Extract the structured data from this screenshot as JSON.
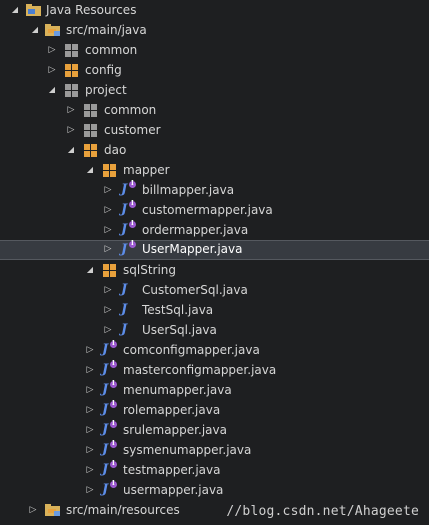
{
  "tree": {
    "root": {
      "label": "Java Resources",
      "icon": "java-resources-icon"
    },
    "src_main_java": {
      "label": "src/main/java",
      "icon": "source-folder-icon"
    },
    "common": {
      "label": "common",
      "icon": "package-icon"
    },
    "config": {
      "label": "config",
      "icon": "package-icon"
    },
    "project": {
      "label": "project",
      "icon": "package-icon"
    },
    "project_common": {
      "label": "common",
      "icon": "package-icon"
    },
    "customer": {
      "label": "customer",
      "icon": "package-icon"
    },
    "dao": {
      "label": "dao",
      "icon": "package-icon"
    },
    "mapper": {
      "label": "mapper",
      "icon": "package-icon"
    },
    "mapper_files": [
      {
        "label": "billmapper.java",
        "icon": "java-interface-icon"
      },
      {
        "label": "customermapper.java",
        "icon": "java-interface-icon"
      },
      {
        "label": "ordermapper.java",
        "icon": "java-interface-icon"
      },
      {
        "label": "UserMapper.java",
        "icon": "java-interface-icon",
        "selected": true
      }
    ],
    "sqlString": {
      "label": "sqlString",
      "icon": "package-icon"
    },
    "sql_files": [
      {
        "label": "CustomerSql.java",
        "icon": "java-class-icon"
      },
      {
        "label": "TestSql.java",
        "icon": "java-class-icon"
      },
      {
        "label": "UserSql.java",
        "icon": "java-class-icon"
      }
    ],
    "dao_files": [
      {
        "label": "comconfigmapper.java",
        "icon": "java-interface-icon"
      },
      {
        "label": "masterconfigmapper.java",
        "icon": "java-interface-icon"
      },
      {
        "label": "menumapper.java",
        "icon": "java-interface-icon"
      },
      {
        "label": "rolemapper.java",
        "icon": "java-interface-icon"
      },
      {
        "label": "srulemapper.java",
        "icon": "java-interface-icon"
      },
      {
        "label": "sysmenumapper.java",
        "icon": "java-interface-icon"
      },
      {
        "label": "testmapper.java",
        "icon": "java-interface-icon"
      },
      {
        "label": "usermapper.java",
        "icon": "java-interface-icon"
      }
    ],
    "src_main_resources": {
      "label": "src/main/resources",
      "icon": "source-folder-icon"
    }
  },
  "watermark": "//blog.csdn.net/Ahageete",
  "colors": {
    "background": "#1e1f21",
    "selection": "#373b41",
    "package_orange": "#e8a13c",
    "package_gray": "#9a9a9a",
    "java_blue": "#5d8de8",
    "interface_purple": "#9b59d0"
  }
}
